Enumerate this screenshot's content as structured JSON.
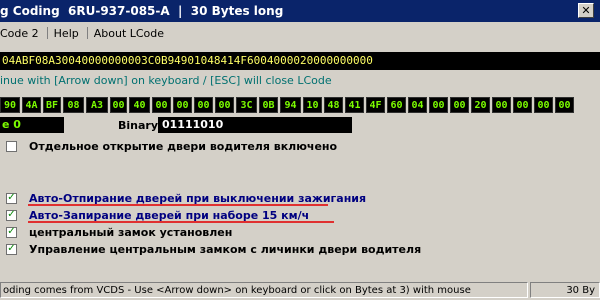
{
  "window": {
    "title": "g Coding  6RU-937-085-A  |  30 Bytes long",
    "close_glyph": "✕"
  },
  "menu": [
    "Code 2",
    "Help",
    "About LCode"
  ],
  "hex_string": "04ABF08A30040000000003C0B94901048414F6004000020000000000",
  "hint": "inue with [Arrow down] on keyboard / [ESC] will close LCode",
  "bytes": [
    "90",
    "4A",
    "BF",
    "08",
    "A3",
    "00",
    "40",
    "00",
    "00",
    "00",
    "00",
    "3C",
    "0B",
    "94",
    "10",
    "48",
    "41",
    "4F",
    "60",
    "04",
    "00",
    "00",
    "20",
    "00",
    "00",
    "00",
    "00"
  ],
  "selected_byte_label": "e 0",
  "binary": {
    "label": "Binary:",
    "value": "01111010"
  },
  "options": [
    {
      "label": "Отдельное открытие двери водителя включено",
      "checked": false,
      "highlighted": false
    },
    {
      "label": "Авто-Отпирание дверей при выключении зажигания",
      "checked": true,
      "highlighted": true
    },
    {
      "label": "Авто-Запирание дверей при наборе 15 км/ч",
      "checked": true,
      "highlighted": true
    },
    {
      "label": "центральный замок установлен",
      "checked": true,
      "highlighted": false
    },
    {
      "label": "Управление центральным замком с личинки двери водителя",
      "checked": true,
      "highlighted": false
    }
  ],
  "checkmark": "✓",
  "status": {
    "main": "oding comes from VCDS - Use <Arrow down> on keyboard or click on Bytes at 3) with mouse",
    "right": "30 By"
  },
  "colors": {
    "titlebar": "#0a246a",
    "byte_text": "#7cfc00",
    "hex_text": "#ffff66",
    "hint_text": "#007070",
    "underline": "#e03030",
    "highlight_label": "#000080"
  }
}
